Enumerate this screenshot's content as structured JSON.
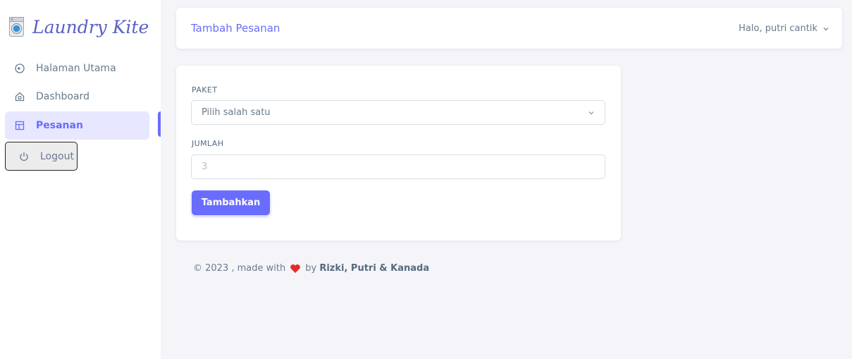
{
  "sidebar": {
    "brand": "Laundry Kite",
    "items": [
      {
        "label": "Halaman Utama",
        "icon": "arrow-circle-left-icon"
      },
      {
        "label": "Dashboard",
        "icon": "home-icon"
      },
      {
        "label": "Pesanan",
        "icon": "layout-icon"
      },
      {
        "label": "Logout",
        "icon": "power-icon"
      }
    ]
  },
  "navbar": {
    "title": "Tambah Pesanan",
    "user": "Halo, putri cantik"
  },
  "form": {
    "paket_label": "PAKET",
    "paket_selected": "Pilih salah satu",
    "jumlah_label": "JUMLAH",
    "jumlah_placeholder": "3",
    "submit_label": "Tambahkan"
  },
  "footer": {
    "prefix": "© 2023 , made with",
    "by": "by",
    "authors": "Rizki, Putri & Kanada"
  },
  "colors": {
    "accent": "#696cff",
    "heart": "#e62a2a"
  }
}
